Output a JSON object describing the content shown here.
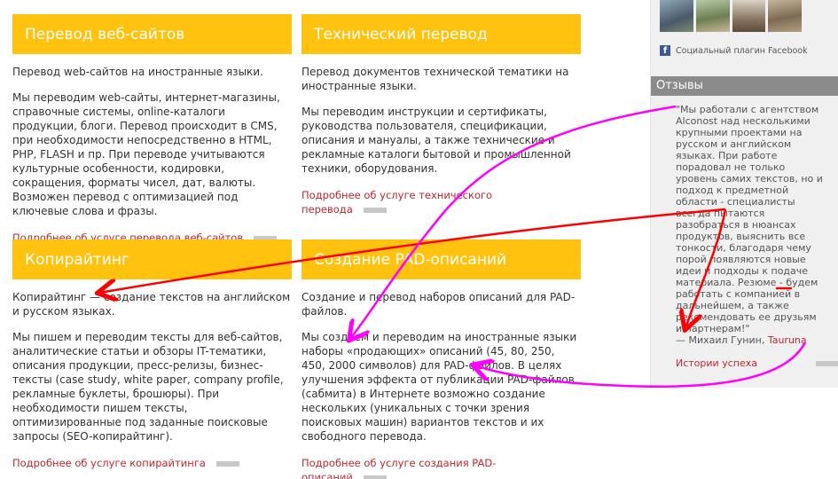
{
  "services": [
    {
      "title": "Перевод веб-сайтов",
      "intro": "Перевод web-сайтов на иностранные языки.",
      "body": "Мы переводим web-сайты, интернет-магазины, справочные системы, online-каталоги продукции, блоги. Перевод происходит в CMS, при необходимости непосредственно в HTML, PHP, FLASH и пр. При переводе учитываются культурные особенности, кодировки, сокращения, форматы чисел, дат, валюты. Возможен перевод с оптимизацией под ключевые слова и фразы.",
      "more": "Подробнее об услуге перевода веб-сайтов"
    },
    {
      "title": "Технический перевод",
      "intro": "Перевод документов технической тематики на иностранные языки.",
      "body": "Мы переводим инструкции и сертификаты, руководства пользователя, спецификации, описания и мануалы, а также технические и рекламные каталоги бытовой и промышленной техники, оборудования.",
      "more": "Подробнее об услуге технического перевода"
    },
    {
      "title": "Копирайтинг",
      "intro": "Копирайтинг — создание текстов на английском и русском языках.",
      "body": "Мы пишем и переводим тексты для веб-сайтов, аналитические статьи и обзоры IT-тематики, описания продукции, пресс-релизы, бизнес-тексты (case study, white paper, company profile, рекламные буклеты, брошюры). При необходимости пишем тексты, оптимизированные под заданные поисковые запросы (SEO-копирайтинг).",
      "more": "Подробнее об услуге копирайтинга"
    },
    {
      "title": "Создание PAD-описаний",
      "intro": "Создание и перевод наборов описаний для PAD-файлов.",
      "body": "Мы создаем и переводим на иностранные языки наборы «продающих» описаний (45, 80, 250, 450, 2000 символов) для PAD-файлов. В целях улучшения эффекта от публикации PAD-файлов (сабмита) в Интернете возможно создание нескольких (уникальных с точки зрения поисковых машин) вариантов текстов и их свободного перевода.",
      "more": "Подробнее об услуге создания PAD-описаний"
    }
  ],
  "sidebar": {
    "facebook_label": "Социальный плагин Facebook",
    "reviews_title": "Отзывы",
    "review_text": "\"Мы работали с агентством Alconost над несколькими крупными проектами на русском и английском языках. При работе порадовал не только уровень самих текстов, но и подход к предметной области - специалисты всегда пытаются разобраться в нюансах продуктов, выяснить все тонкости, благодаря чему порой появляются новые идеи и подходы к подаче материала. Резюме - будем работать с компанией в дальнейшем, а также рекомендовать ее друзьям и партнерам!\"",
    "review_author_prefix": "— Михаил Гунин,",
    "review_company": "Tauruna",
    "success_stories": "Истории успеха"
  },
  "colors": {
    "header_bg": "#ffc20e",
    "link": "#c1272d",
    "annotation_red": "#ff0000",
    "annotation_magenta": "#ff00ff"
  },
  "icons": [
    "facebook-icon"
  ]
}
